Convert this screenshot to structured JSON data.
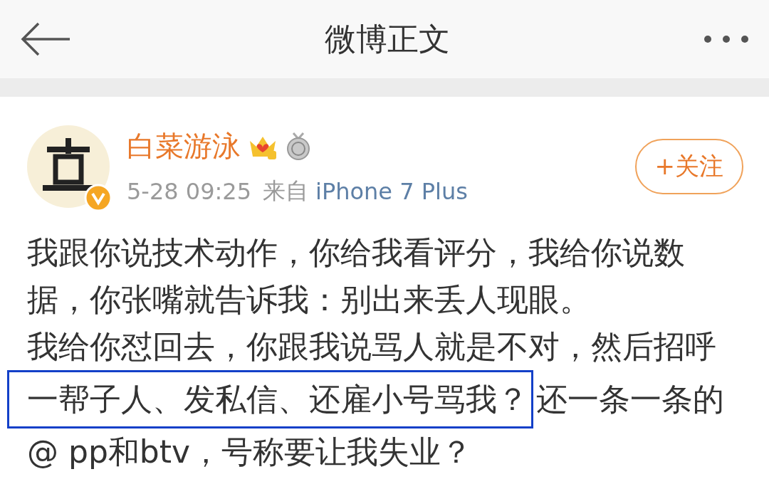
{
  "header": {
    "title": "微博正文"
  },
  "post": {
    "author": "白菜游泳",
    "time": "5-28 09:25",
    "source_prefix": "来自",
    "source": "iPhone 7 Plus",
    "verified": true,
    "follow_label": "+关注",
    "lines": [
      {
        "segments": [
          {
            "text": "我跟你说技术动作，你给我看评分，我给你说数",
            "highlighted": false
          }
        ]
      },
      {
        "segments": [
          {
            "text": "据，你张嘴就告诉我：别出来丢人现眼。",
            "highlighted": false
          }
        ]
      },
      {
        "segments": [
          {
            "text": "我给你怼回去，你跟我说骂人就是不对，然后招呼",
            "highlighted": false
          }
        ]
      },
      {
        "segments": [
          {
            "text": "一帮子人、发私信、还雇小号骂我？",
            "highlighted": true
          },
          {
            "text": "还一条一条的",
            "highlighted": false
          }
        ]
      },
      {
        "segments": [
          {
            "text": "@ pp和btv，号称要让我失业？",
            "highlighted": false
          }
        ]
      }
    ]
  }
}
